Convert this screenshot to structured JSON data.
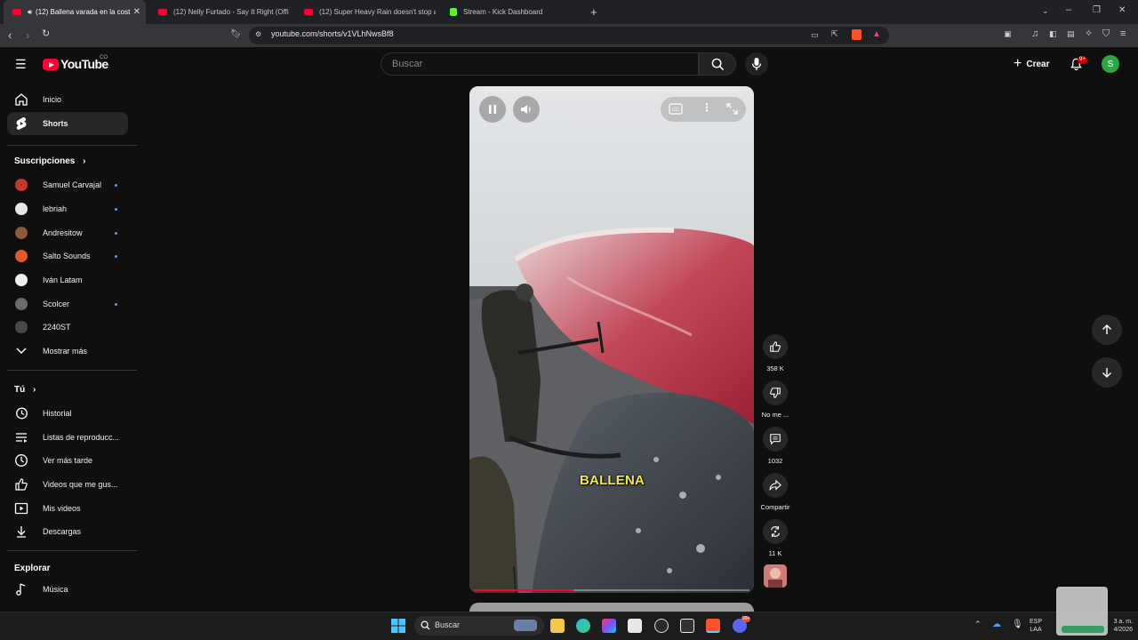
{
  "browser": {
    "tabs": [
      {
        "title": "(12) Ballena varada en la cost",
        "active": true
      },
      {
        "title": "(12) Nelly Furtado - Say It Right (Offi",
        "active": false
      },
      {
        "title": "(12) Super Heavy Rain doesn't stop a",
        "active": false
      },
      {
        "title": "Stream - Kick Dashboard",
        "active": false
      }
    ],
    "url": "youtube.com/shorts/v1VLhNwsBf8"
  },
  "header": {
    "logo": "YouTube",
    "country": "CO",
    "search_placeholder": "Buscar",
    "create_label": "Crear",
    "notifications_badge": "9+",
    "avatar_letter": "S"
  },
  "sidebar": {
    "main": [
      {
        "label": "Inicio",
        "icon": "home-icon"
      },
      {
        "label": "Shorts",
        "icon": "shorts-icon",
        "selected": true
      }
    ],
    "subscriptions_heading": "Suscripciones",
    "subscriptions": [
      {
        "label": "Samuel Carvajal",
        "color": "#c0392b",
        "new": true
      },
      {
        "label": "lebriah",
        "color": "#e6e6e6",
        "new": true
      },
      {
        "label": "Andresitow",
        "color": "#8e5a3c",
        "new": true
      },
      {
        "label": "Salto Sounds",
        "color": "#e2572b",
        "new": true
      },
      {
        "label": "Iván Latam",
        "color": "#f0f0f0",
        "new": false
      },
      {
        "label": "Scolcer",
        "color": "#6b6b6b",
        "new": true
      },
      {
        "label": "2240ST",
        "color": "#4a4a4a",
        "new": false
      }
    ],
    "show_more": "Mostrar más",
    "you_heading": "Tú",
    "you_items": [
      {
        "label": "Historial",
        "icon": "history-icon"
      },
      {
        "label": "Listas de reproducc...",
        "icon": "playlists-icon"
      },
      {
        "label": "Ver más tarde",
        "icon": "watch-later-icon"
      },
      {
        "label": "Videos que me gus...",
        "icon": "liked-videos-icon"
      },
      {
        "label": "Mis videos",
        "icon": "my-videos-icon"
      },
      {
        "label": "Descargas",
        "icon": "downloads-icon"
      }
    ],
    "explore_heading": "Explorar",
    "explore_items": [
      {
        "label": "Música",
        "icon": "music-icon"
      }
    ]
  },
  "video": {
    "caption": "BALLENA",
    "progress": 0.36
  },
  "actions": {
    "likes": "358 K",
    "dislike_label": "No me ...",
    "comments": "1032",
    "share_label": "Compartir",
    "remix_count": "11 K"
  },
  "taskbar": {
    "search_label": "Buscar",
    "lang_top": "ESP",
    "lang_bottom": "LAA",
    "time": "3 a. m.",
    "date": "4/2026",
    "badge": "99+"
  }
}
